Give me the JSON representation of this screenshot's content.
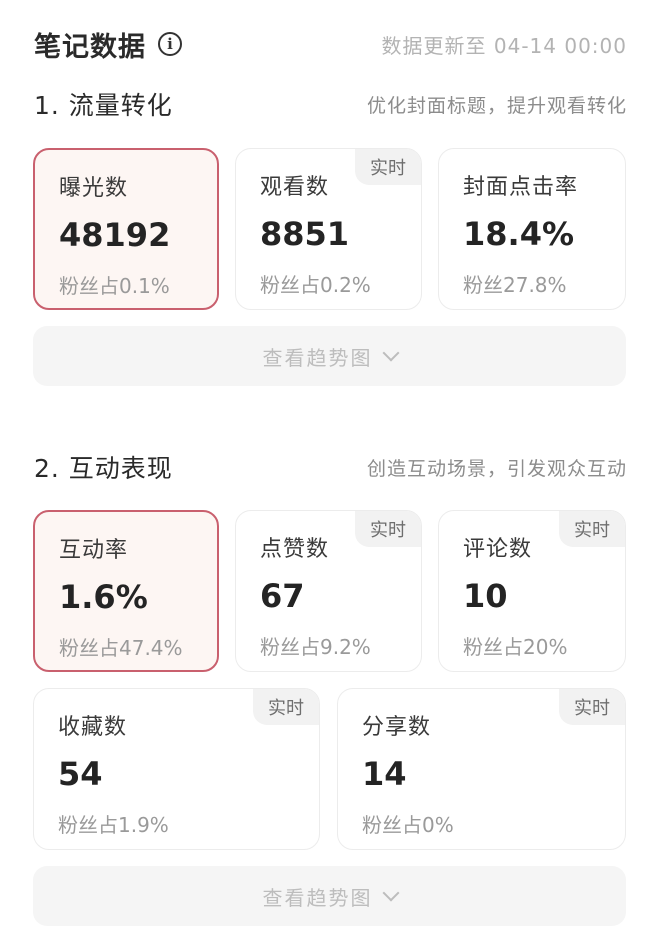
{
  "header": {
    "title": "笔记数据",
    "info_icon": "i",
    "update_time": "数据更新至 04-14 00:00"
  },
  "sections": [
    {
      "title": "1. 流量转化",
      "tip": "优化封面标题，提升观看转化",
      "cards": [
        {
          "label": "曝光数",
          "value": "48192",
          "sub": "粉丝占0.1%",
          "badge": ""
        },
        {
          "label": "观看数",
          "value": "8851",
          "sub": "粉丝占0.2%",
          "badge": "实时"
        },
        {
          "label": "封面点击率",
          "value": "18.4%",
          "sub": "粉丝27.8%",
          "badge": ""
        }
      ],
      "trend_label": "查看趋势图"
    },
    {
      "title": "2. 互动表现",
      "tip": "创造互动场景，引发观众互动",
      "cards": [
        {
          "label": "互动率",
          "value": "1.6%",
          "sub": "粉丝占47.4%",
          "badge": ""
        },
        {
          "label": "点赞数",
          "value": "67",
          "sub": "粉丝占9.2%",
          "badge": "实时"
        },
        {
          "label": "评论数",
          "value": "10",
          "sub": "粉丝占20%",
          "badge": "实时"
        },
        {
          "label": "收藏数",
          "value": "54",
          "sub": "粉丝占1.9%",
          "badge": "实时"
        },
        {
          "label": "分享数",
          "value": "14",
          "sub": "粉丝占0%",
          "badge": "实时"
        }
      ],
      "trend_label": "查看趋势图"
    }
  ],
  "colors": {
    "highlight_border": "#c9606e",
    "highlight_bg": "#fdf6f3",
    "badge_bg": "#f2f2f2"
  }
}
